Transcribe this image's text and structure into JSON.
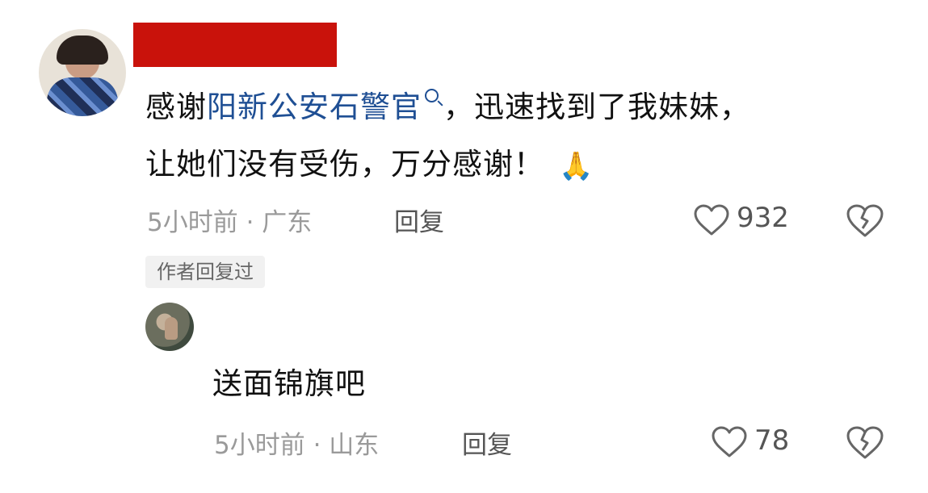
{
  "comment": {
    "text_prefix": "感谢",
    "link_text": "阳新公安石警官",
    "text_after_link": "，迅速找到了我妹妹，",
    "line2": "让她们没有受伤，万分感谢！",
    "emoji": "🙏",
    "meta": "5小时前 · 广东",
    "reply_label": "回复",
    "likes": "932",
    "author_badge": "作者回复过"
  },
  "reply": {
    "text": "送面锦旗吧",
    "meta": "5小时前 · 山东",
    "reply_label": "回复",
    "likes": "78"
  },
  "icons": {
    "like": "heart-outline-icon",
    "dislike": "broken-heart-icon",
    "search": "search-icon"
  },
  "colors": {
    "link": "#1f4f94",
    "redaction": "#c9120b"
  }
}
